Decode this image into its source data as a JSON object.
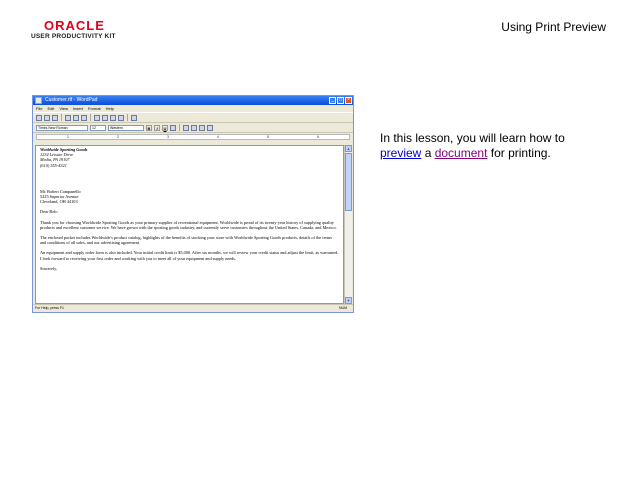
{
  "brand": {
    "logo": "ORACLE",
    "kit": "USER PRODUCTIVITY KIT"
  },
  "header": {
    "title": "Using Print Preview"
  },
  "window": {
    "title": "Customer.rtf - WordPad",
    "menu": [
      "File",
      "Edit",
      "View",
      "Insert",
      "Format",
      "Help"
    ],
    "toolbar_icons": [
      "new-icon",
      "open-icon",
      "save-icon",
      "print-icon",
      "print-preview-icon",
      "find-icon",
      "cut-icon",
      "copy-icon",
      "paste-icon",
      "undo-icon",
      "date-time-icon"
    ],
    "format": {
      "font": "Times New Roman",
      "size": "12",
      "script": "Western",
      "buttons": [
        "B",
        "I",
        "U"
      ]
    },
    "ruler_marks": [
      "1",
      "2",
      "3",
      "4",
      "5",
      "6"
    ],
    "document": {
      "company": "Worldwide Sporting Goods",
      "sender_address": [
        "1234 Leisure Drive",
        "Media, PA 19107",
        "(610) 555-4321"
      ],
      "recipient": [
        "Mr. Robert Campanello",
        "5225 Superior Avenue",
        "Cleveland, OH 44103"
      ],
      "greeting": "Dear Rob:",
      "paragraphs": [
        "Thank you for choosing Worldwide Sporting Goods as your primary supplier of recreational equipment. Worldwide is proud of its twenty-year history of supplying quality products and excellent customer service. We have grown with the sporting goods industry, and currently serve customers throughout the United States, Canada, and Mexico.",
        "The enclosed packet includes Worldwide's product catalog, highlights of the benefits of stocking your store with Worldwide Sporting Goods products, details of the terms and conditions of all sales, and our advertising agreement.",
        "An equipment and supply order form is also included. Your initial credit limit is $5,000. After six months, we will review your credit status and adjust the limit, as warranted. I look forward to receiving your first order and working with you to meet all of your equipment and supply needs."
      ],
      "closing": "Sincerely,"
    },
    "status": {
      "text": "For Help, press F1",
      "mode": "NUM"
    }
  },
  "lesson": {
    "prefix": "In this lesson, you will learn how to",
    "link1": "preview",
    "middle": " a ",
    "link2": "document",
    "suffix": " for printing."
  }
}
